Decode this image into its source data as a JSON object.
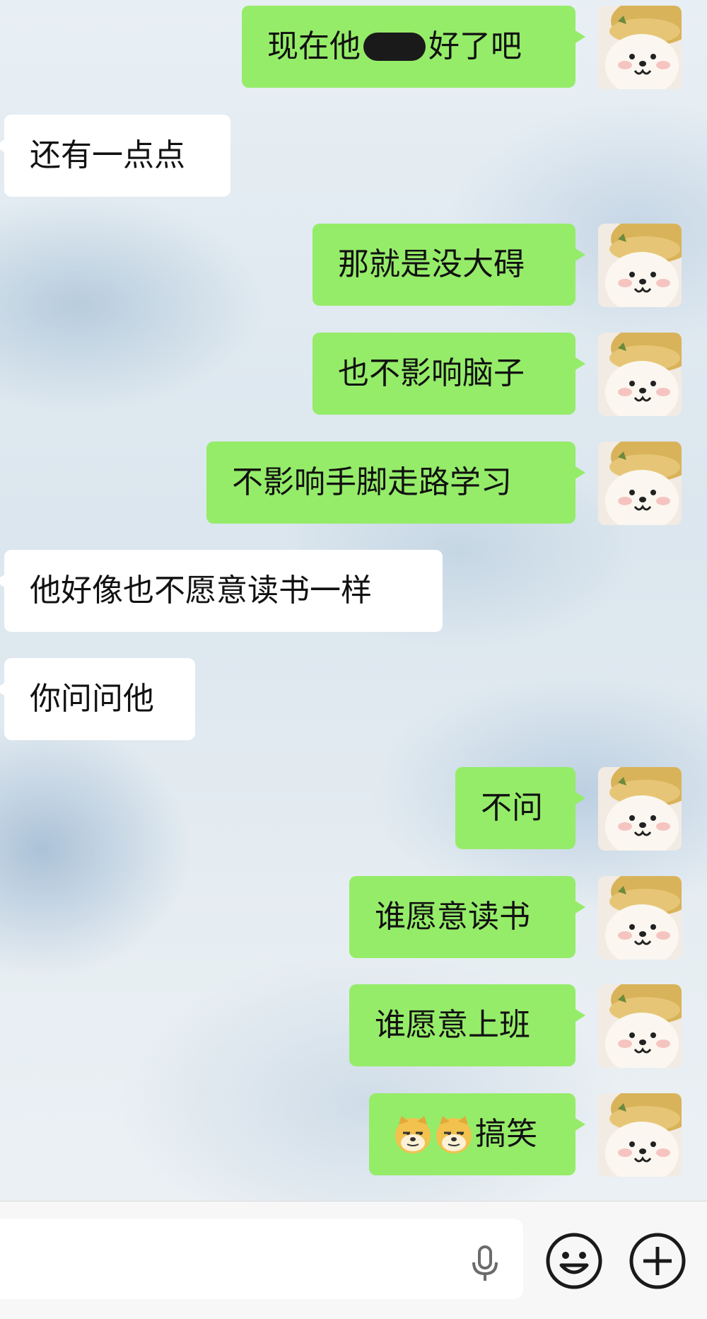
{
  "chat": {
    "messages": [
      {
        "side": "out",
        "text_before": "现在他",
        "text_after": "好了吧"
      },
      {
        "side": "in",
        "text": "还有一点点"
      },
      {
        "side": "out",
        "text": "那就是没大碍"
      },
      {
        "side": "out",
        "text": "也不影响脑子"
      },
      {
        "side": "out",
        "text": "不影响手脚走路学习"
      },
      {
        "side": "in",
        "text": "他好像也不愿意读书一样"
      },
      {
        "side": "in",
        "text": "你问问他"
      },
      {
        "side": "out",
        "text": "不问"
      },
      {
        "side": "out",
        "text": "谁愿意读书"
      },
      {
        "side": "out",
        "text": "谁愿意上班"
      },
      {
        "side": "out",
        "emoji": "doge-emoji",
        "emoji_count": 2,
        "text": "搞笑"
      }
    ]
  },
  "input_bar": {
    "voice_icon": "microphone-icon",
    "emoji_button_icon": "smiley-face-icon",
    "add_button_icon": "plus-circle-icon"
  },
  "colors": {
    "outgoing_bubble": "#95ec69",
    "incoming_bubble": "#ffffff",
    "input_bar": "#f7f7f7"
  }
}
